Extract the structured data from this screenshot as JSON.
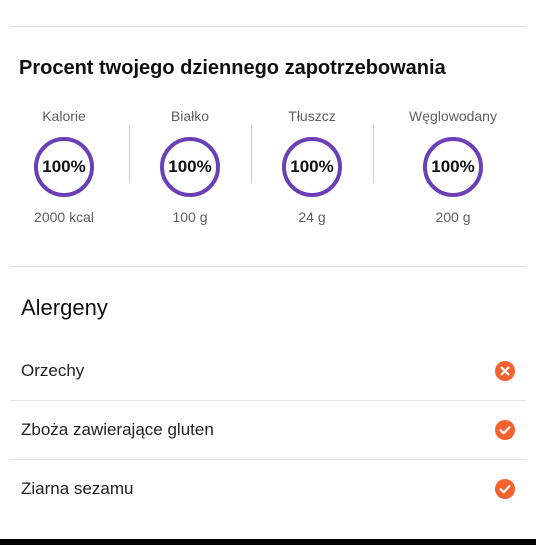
{
  "daily_needs": {
    "title": "Procent twojego dziennego zapotrzebowania",
    "nutrients": [
      {
        "label": "Kalorie",
        "percent": "100%",
        "amount": "2000 kcal"
      },
      {
        "label": "Białko",
        "percent": "100%",
        "amount": "100 g"
      },
      {
        "label": "Tłuszcz",
        "percent": "100%",
        "amount": "24 g"
      },
      {
        "label": "Węglowodany",
        "percent": "100%",
        "amount": "200 g"
      }
    ]
  },
  "allergens": {
    "title": "Alergeny",
    "items": [
      {
        "name": "Orzechy",
        "status": "absent",
        "icon": "x-circle-icon"
      },
      {
        "name": "Zboża zawierające gluten",
        "status": "present",
        "icon": "check-circle-icon"
      },
      {
        "name": "Ziarna sezamu",
        "status": "present",
        "icon": "check-circle-icon"
      }
    ]
  },
  "colors": {
    "ring": "#6b3fb6",
    "status_icon": "#f4622f"
  }
}
